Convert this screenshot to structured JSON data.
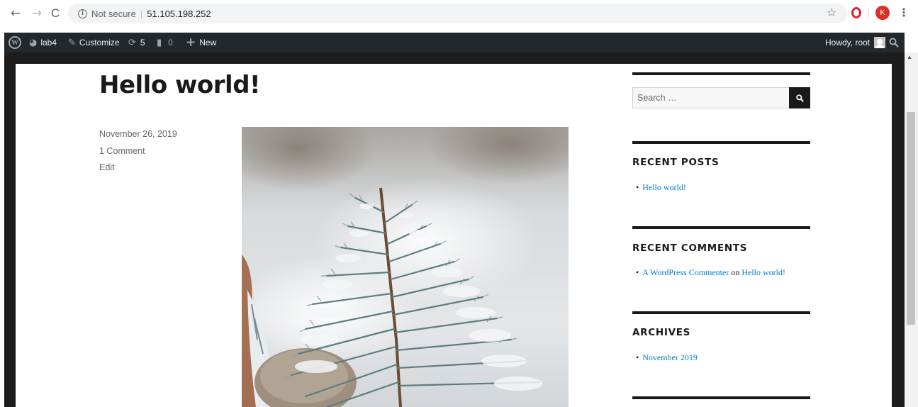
{
  "browser": {
    "back_glyph": "←",
    "forward_glyph": "→",
    "reload_glyph": "C",
    "info_glyph": "i",
    "secure_label": "Not secure",
    "separator": "|",
    "url": "51.105.198.252",
    "star_glyph": "☆",
    "profile_initial": "K",
    "menu_glyph": "⋮"
  },
  "admin_bar": {
    "wp_logo_glyph": "W",
    "site_name": "lab4",
    "customize_label": "Customize",
    "updates_count": "5",
    "comments_count": "0",
    "new_label": "New",
    "howdy_label": "Howdy, root"
  },
  "post": {
    "title": "Hello world!",
    "date": "November 26, 2019",
    "comments_link": "1 Comment",
    "edit_link": "Edit"
  },
  "sidebar": {
    "search_placeholder": "Search …",
    "recent_posts_title": "RECENT POSTS",
    "recent_posts": [
      "Hello world!"
    ],
    "recent_comments_title": "RECENT COMMENTS",
    "recent_comment": {
      "author": "A WordPress Commenter",
      "on_text": "on",
      "post": "Hello world!"
    },
    "archives_title": "ARCHIVES",
    "archives": [
      "November 2019"
    ]
  },
  "colors": {
    "admin_bar_bg": "#23282d",
    "link": "#007acc",
    "text": "#1a1a1a",
    "meta": "#686868"
  }
}
